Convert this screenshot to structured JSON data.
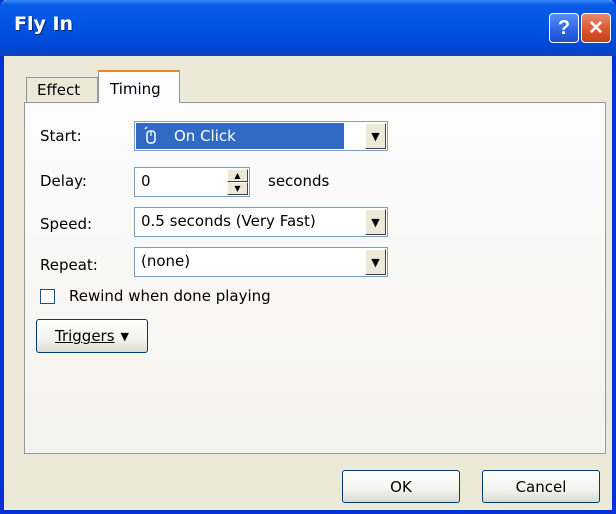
{
  "window": {
    "title": "Fly In",
    "help_glyph": "?",
    "close_glyph": "✕"
  },
  "tabs": [
    {
      "label": "Effect",
      "selected": false
    },
    {
      "label": "Timing",
      "selected": true
    }
  ],
  "timing": {
    "start": {
      "label": "Start:",
      "value": "On Click"
    },
    "delay": {
      "label": "Delay:",
      "value": "0",
      "unit": "seconds"
    },
    "speed": {
      "label": "Speed:",
      "value": "0.5 seconds (Very Fast)"
    },
    "repeat": {
      "label": "Repeat:",
      "value": "(none)"
    },
    "rewind": {
      "label": "Rewind when done playing",
      "checked": false
    },
    "triggers_label": "Triggers",
    "triggers_glyph": "▼"
  },
  "footer": {
    "ok_label": "OK",
    "cancel_label": "Cancel"
  },
  "icons": {
    "mouse": "mouse-icon",
    "dropdown": "chevron-down-icon"
  },
  "colors": {
    "titlebar": "#0055e5",
    "selection": "#316ac5",
    "close_button": "#d9532c",
    "tab_highlight": "#e68b2c",
    "dialog_face": "#ece9d8"
  }
}
